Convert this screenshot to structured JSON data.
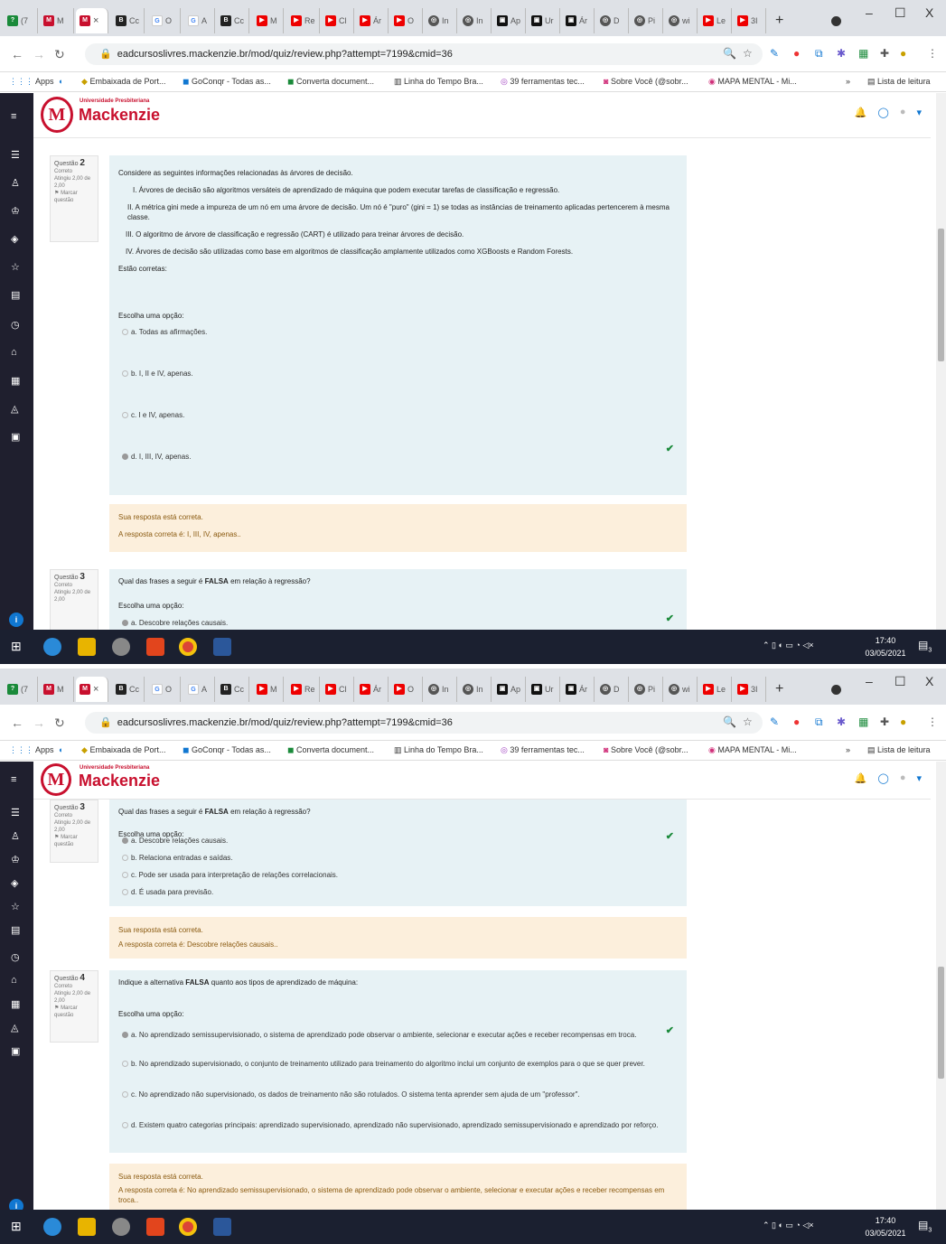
{
  "browser": {
    "tabs": [
      "(7",
      "M",
      "",
      "Cc",
      "O",
      "A",
      "Cc",
      "M",
      "Re",
      "Cl",
      "Ár",
      "O",
      "In",
      "In",
      "Ap",
      "Ur",
      "Ár",
      "D",
      "Pi",
      "wi",
      "Le",
      "3I"
    ],
    "active_tab_close": "×",
    "new_tab": "+",
    "minimize": "–",
    "maximize": "☐",
    "close": "X",
    "url": "eadcursoslivres.mackenzie.br/mod/quiz/review.php?attempt=7199&cmid=36",
    "bookmarks": [
      "Apps",
      "Embaixada de Port...",
      "GoConqr - Todas as...",
      "Converta document...",
      "Linha do Tempo Bra...",
      "39 ferramentas tec...",
      "Sobre Você (@sobr...",
      "MAPA MENTAL - Mi..."
    ],
    "bookmarks_more": "»",
    "reading_list": "Lista de leitura"
  },
  "site": {
    "logo_letter": "M",
    "logo_sub": "Universidade Presbiteriana",
    "logo_name": "Mackenzie"
  },
  "q2": {
    "label": "Questão",
    "number": "2",
    "status": "Correto",
    "grade": "Atingiu 2,00 de 2,00",
    "flag": "Marcar questão",
    "intro": "Considere as seguintes informações relacionadas às árvores de decisão.",
    "items": [
      "I.   Árvores de decisão são algoritmos versáteis de aprendizado de máquina que podem executar tarefas de classificação e regressão.",
      "II.   A métrica gini mede a impureza de um nó em uma árvore de decisão. Um nó é \"puro\" (gini = 1) se todas as instâncias de treinamento aplicadas pertencerem à mesma classe.",
      "III.   O algoritmo de árvore de classificação e regressão (CART) é utilizado para treinar árvores de decisão.",
      "IV.   Árvores de decisão são utilizadas como base em algoritmos de classificação amplamente utilizados como XGBoosts e Random Forests."
    ],
    "ask": "Estão corretas:",
    "choose": "Escolha uma opção:",
    "options": [
      "a. Todas as afirmações.",
      "b. I, II e IV, apenas.",
      "c. I e IV, apenas.",
      "d. I, III, IV, apenas."
    ],
    "feedback1": "Sua resposta está correta.",
    "feedback2": "A resposta correta é: I, III, IV, apenas.."
  },
  "q3": {
    "label": "Questão",
    "number": "3",
    "status": "Correto",
    "grade": "Atingiu 2,00 de 2,00",
    "flag": "Marcar questão",
    "text_pre": "Qual das frases a seguir é ",
    "text_bold": "FALSA",
    "text_post": " em relação à regressão?",
    "choose": "Escolha uma opção:",
    "options": [
      "a. Descobre relações causais.",
      "b. Relaciona entradas e saídas.",
      "c. Pode ser usada para interpretação de relações correlacionais.",
      "d.  É usada para previsão."
    ],
    "feedback1": "Sua resposta está correta.",
    "feedback2": "A resposta correta é: Descobre relações causais.."
  },
  "q4": {
    "label": "Questão",
    "number": "4",
    "status": "Correto",
    "grade": "Atingiu 2,00 de 2,00",
    "flag": "Marcar questão",
    "text_pre": "Indique a alternativa ",
    "text_bold": "FALSA",
    "text_post": " quanto aos tipos de aprendizado de máquina:",
    "choose": "Escolha uma opção:",
    "options": [
      "a. No aprendizado semissupervisionado, o sistema de aprendizado pode observar o ambiente, selecionar e executar ações e receber recompensas em troca.",
      "b. No aprendizado supervisionado, o conjunto de treinamento utilizado para treinamento do algoritmo inclui um conjunto de exemplos para o que se quer prever.",
      "c. No aprendizado não supervisionado, os dados de treinamento não são rotulados. O sistema tenta aprender sem ajuda de um \"professor\".",
      "d. Existem quatro categorias principais: aprendizado supervisionado, aprendizado não supervisionado, aprendizado semissupervisionado e aprendizado por reforço."
    ],
    "feedback1": "Sua resposta está correta.",
    "feedback2": "A resposta correta é: No aprendizado semissupervisionado, o sistema de aprendizado pode observar o ambiente, selecionar e executar ações e receber recompensas em troca.."
  },
  "taskbar": {
    "time": "17:40",
    "date": "03/05/2021",
    "notif_count": "3"
  }
}
